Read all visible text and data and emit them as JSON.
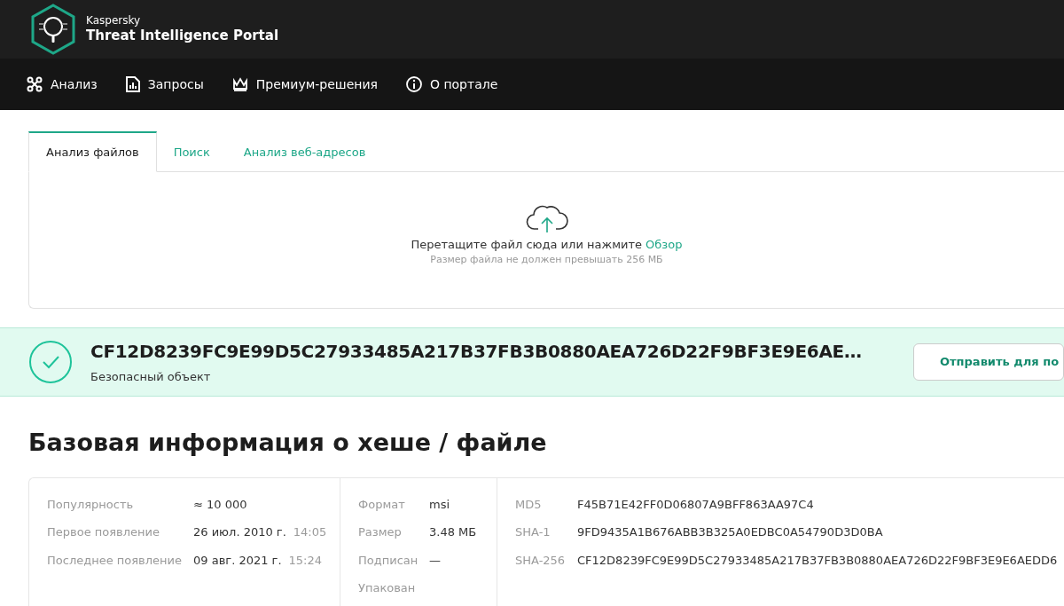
{
  "brand": {
    "company": "Kaspersky",
    "product": "Threat Intelligence Portal"
  },
  "nav": [
    {
      "kind": "analysis",
      "label": "Анализ"
    },
    {
      "kind": "requests",
      "label": "Запросы"
    },
    {
      "kind": "premium",
      "label": "Премиум-решения"
    },
    {
      "kind": "about",
      "label": "О портале"
    }
  ],
  "tabs": [
    {
      "label": "Анализ файлов",
      "selected": true
    },
    {
      "label": "Поиск",
      "selected": false
    },
    {
      "label": "Анализ веб-адресов",
      "selected": false
    }
  ],
  "upload": {
    "prompt": "Перетащите файл сюда или нажмите",
    "link": "Обзор",
    "hint": "Размер файла не должен превышать 256 МБ"
  },
  "result": {
    "hash": "CF12D8239FC9E99D5C27933485A217B37FB3B0880AEA726D22F9BF3E9E6AE…",
    "verdict": "Безопасный объект",
    "button": "Отправить для по"
  },
  "section_title": "Базовая информация о хеше / файле",
  "info_columns": [
    [
      {
        "label": "Популярность",
        "value": "≈ 10 000"
      },
      {
        "label": "Первое появление",
        "value": "26 июл. 2010 г.",
        "time": "14:05"
      },
      {
        "label": "Последнее появление",
        "value": "09 авг. 2021 г.",
        "time": "15:24"
      }
    ],
    [
      {
        "label": "Формат",
        "value": "msi"
      },
      {
        "label": "Размер",
        "value": "3.48 МБ"
      },
      {
        "label": "Подписан",
        "value": "—"
      },
      {
        "label": "Упакован"
      }
    ],
    [
      {
        "label": "MD5",
        "value": "F45B71E42FF0D06807A9BFF863AA97C4"
      },
      {
        "label": "SHA-1",
        "value": "9FD9435A1B676ABB3B325A0EDBC0A54790D3D0BA"
      },
      {
        "label": "SHA-256",
        "value": "CF12D8239FC9E99D5C27933485A217B37FB3B0880AEA726D22F9BF3E9E6AEDD6"
      }
    ]
  ]
}
